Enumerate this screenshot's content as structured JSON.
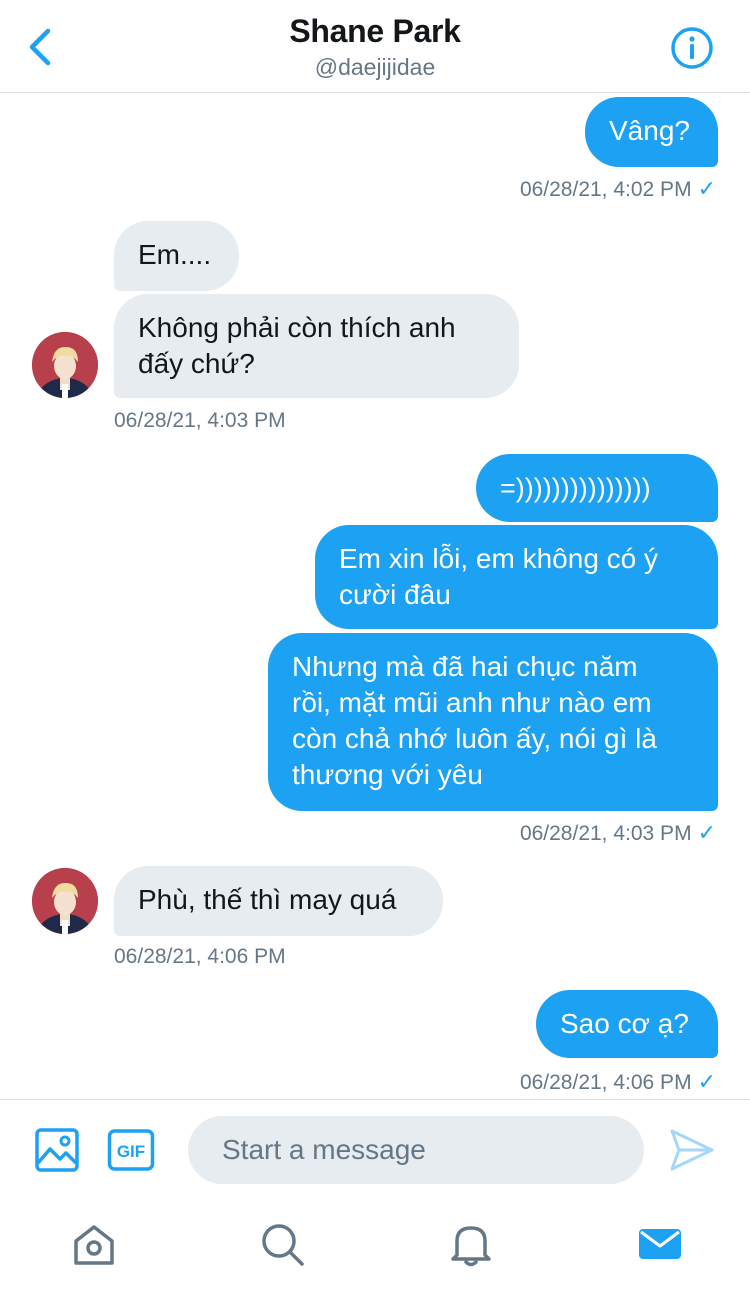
{
  "header": {
    "name": "Shane Park",
    "handle": "@daejijidae"
  },
  "messages": [
    {
      "direction": "sent",
      "text": "Vâng?"
    },
    {
      "direction": "sent",
      "meta": "06/28/21, 4:02 PM",
      "check": "✓"
    },
    {
      "direction": "received",
      "text": "Em...."
    },
    {
      "direction": "received",
      "text": "Không phải còn thích anh\nđấy chứ?"
    },
    {
      "direction": "received",
      "meta": "06/28/21, 4:03 PM"
    },
    {
      "direction": "sent",
      "text": "=)))))))))))))))"
    },
    {
      "direction": "sent",
      "text": "Em xin lỗi, em không có ý\ncười đâu"
    },
    {
      "direction": "sent",
      "text": "Nhưng mà đã hai chục năm\nrồi, mặt mũi anh như nào em\ncòn chả nhớ luôn ấy, nói gì là\nthương với yêu"
    },
    {
      "direction": "sent",
      "meta": "06/28/21, 4:03 PM",
      "check": "✓"
    },
    {
      "direction": "received",
      "text": "Phù, thế thì may quá"
    },
    {
      "direction": "received",
      "meta": "06/28/21, 4:06 PM"
    },
    {
      "direction": "sent",
      "text": "Sao cơ ạ?"
    },
    {
      "direction": "sent",
      "meta": "06/28/21, 4:06 PM",
      "check": "✓"
    }
  ],
  "composer": {
    "placeholder": "Start a message",
    "gif_label": "GIF"
  },
  "icons": {
    "back": "chevron-left-icon",
    "info": "info-icon",
    "image": "image-icon",
    "gif": "gif-icon",
    "send": "send-icon",
    "home": "home-icon",
    "search": "search-icon",
    "notifications": "bell-icon",
    "messages": "mail-icon"
  },
  "colors": {
    "accent": "#1da1f2",
    "received_bubble": "#e6ecf0",
    "meta_text": "#657786"
  }
}
